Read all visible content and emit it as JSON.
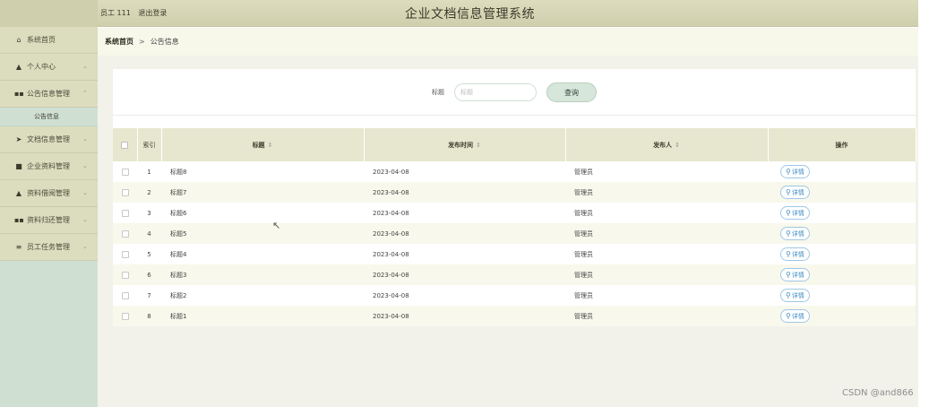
{
  "header": {
    "user_label": "员工 111",
    "logout_label": "退出登录",
    "app_title": "企业文档信息管理系统"
  },
  "sidebar": {
    "items": [
      {
        "label": "系统首页",
        "icon": "home-icon",
        "glyph": "⌂",
        "has_chevron": false
      },
      {
        "label": "个人中心",
        "icon": "user-icon",
        "glyph": "▲",
        "has_chevron": true
      },
      {
        "label": "公告信息管理",
        "icon": "grid-icon",
        "glyph": "▪▪",
        "has_chevron": true,
        "expanded": true
      },
      {
        "label": "文档信息管理",
        "icon": "send-icon",
        "glyph": "➤",
        "has_chevron": true
      },
      {
        "label": "企业资料管理",
        "icon": "database-icon",
        "glyph": "■",
        "has_chevron": true
      },
      {
        "label": "资料借阅管理",
        "icon": "user-icon",
        "glyph": "▲",
        "has_chevron": true
      },
      {
        "label": "资料归还管理",
        "icon": "grid-icon",
        "glyph": "▪▪",
        "has_chevron": true
      },
      {
        "label": "员工任务管理",
        "icon": "list-icon",
        "glyph": "≡",
        "has_chevron": true
      }
    ],
    "submenu_active": "公告信息"
  },
  "breadcrumb": {
    "home": "系统首页",
    "separator": ">",
    "current": "公告信息"
  },
  "search": {
    "label": "标题",
    "placeholder": "标题",
    "button": "查询"
  },
  "table": {
    "columns": {
      "index": "索引",
      "title": "标题",
      "publish_time": "发布时间",
      "publisher": "发布人",
      "operation": "操作"
    },
    "sort_glyph": "⇕",
    "rows": [
      {
        "index": "1",
        "title": "标题8",
        "time": "2023-04-08",
        "publisher": "管理员",
        "action": "详情"
      },
      {
        "index": "2",
        "title": "标题7",
        "time": "2023-04-08",
        "publisher": "管理员",
        "action": "详情"
      },
      {
        "index": "3",
        "title": "标题6",
        "time": "2023-04-08",
        "publisher": "管理员",
        "action": "详情"
      },
      {
        "index": "4",
        "title": "标题5",
        "time": "2023-04-08",
        "publisher": "管理员",
        "action": "详情"
      },
      {
        "index": "5",
        "title": "标题4",
        "time": "2023-04-08",
        "publisher": "管理员",
        "action": "详情"
      },
      {
        "index": "6",
        "title": "标题3",
        "time": "2023-04-08",
        "publisher": "管理员",
        "action": "详情"
      },
      {
        "index": "7",
        "title": "标题2",
        "time": "2023-04-08",
        "publisher": "管理员",
        "action": "详情"
      },
      {
        "index": "8",
        "title": "标题1",
        "time": "2023-04-08",
        "publisher": "管理员",
        "action": "详情"
      }
    ]
  },
  "watermark": "CSDN @and866",
  "colors": {
    "header_bg": "#d5d5b5",
    "sidebar_submenu_bg": "#cfe0d2",
    "detail_accent": "#3d8ac4"
  }
}
